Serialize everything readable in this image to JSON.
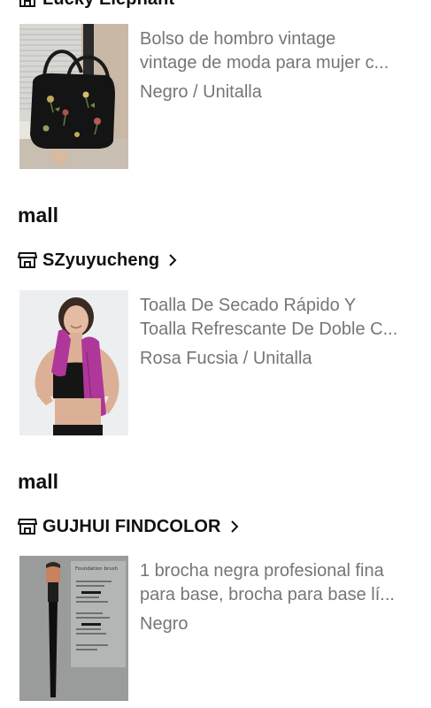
{
  "stores": [
    {
      "name": "Lucky Elephant"
    },
    {
      "name": "SZyuyucheng"
    },
    {
      "name": "GUJHUI FINDCOLOR"
    }
  ],
  "sections": [
    {
      "label": "mall"
    },
    {
      "label": "mall"
    }
  ],
  "items": [
    {
      "title_line1": "Bolso de hombro vintage",
      "title_line2": "vintage de moda para mujer c...",
      "variant": "Negro / Unitalla",
      "image_icon": "floral-black-shoulder-bag-photo"
    },
    {
      "title_line1": "Toalla De Secado Rápido Y",
      "title_line2": "Toalla Refrescante De Doble C...",
      "variant": "Rosa Fucsia / Unitalla",
      "image_icon": "woman-with-pink-towel-photo"
    },
    {
      "title_line1": "1 brocha negra profesional fina",
      "title_line2": "para base, brocha para base lí...",
      "variant": "Negro",
      "image_icon": "black-foundation-brush-photo",
      "image_text": "Foundation brush"
    }
  ],
  "colors": {
    "text_primary": "#111111",
    "text_secondary": "#767676",
    "background": "#ffffff",
    "towel_pink": "#b0379a"
  }
}
